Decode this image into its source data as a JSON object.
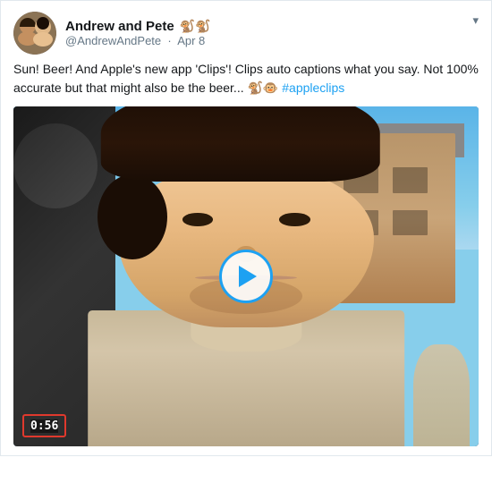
{
  "tweet": {
    "display_name": "Andrew and Pete",
    "emoji_monkeys": "🐒🐒",
    "handle": "@AndrewAndPete",
    "date": "Apr 8",
    "tweet_text": "Sun! Beer! And Apple's new app 'Clips'! Clips auto captions what you say. Not 100% accurate but that might also be the beer... 🐒🐵",
    "hashtag_text": "#appleclips",
    "hashtag_href": "#appleclips",
    "video_duration": "0:56",
    "chevron_label": "▾"
  }
}
